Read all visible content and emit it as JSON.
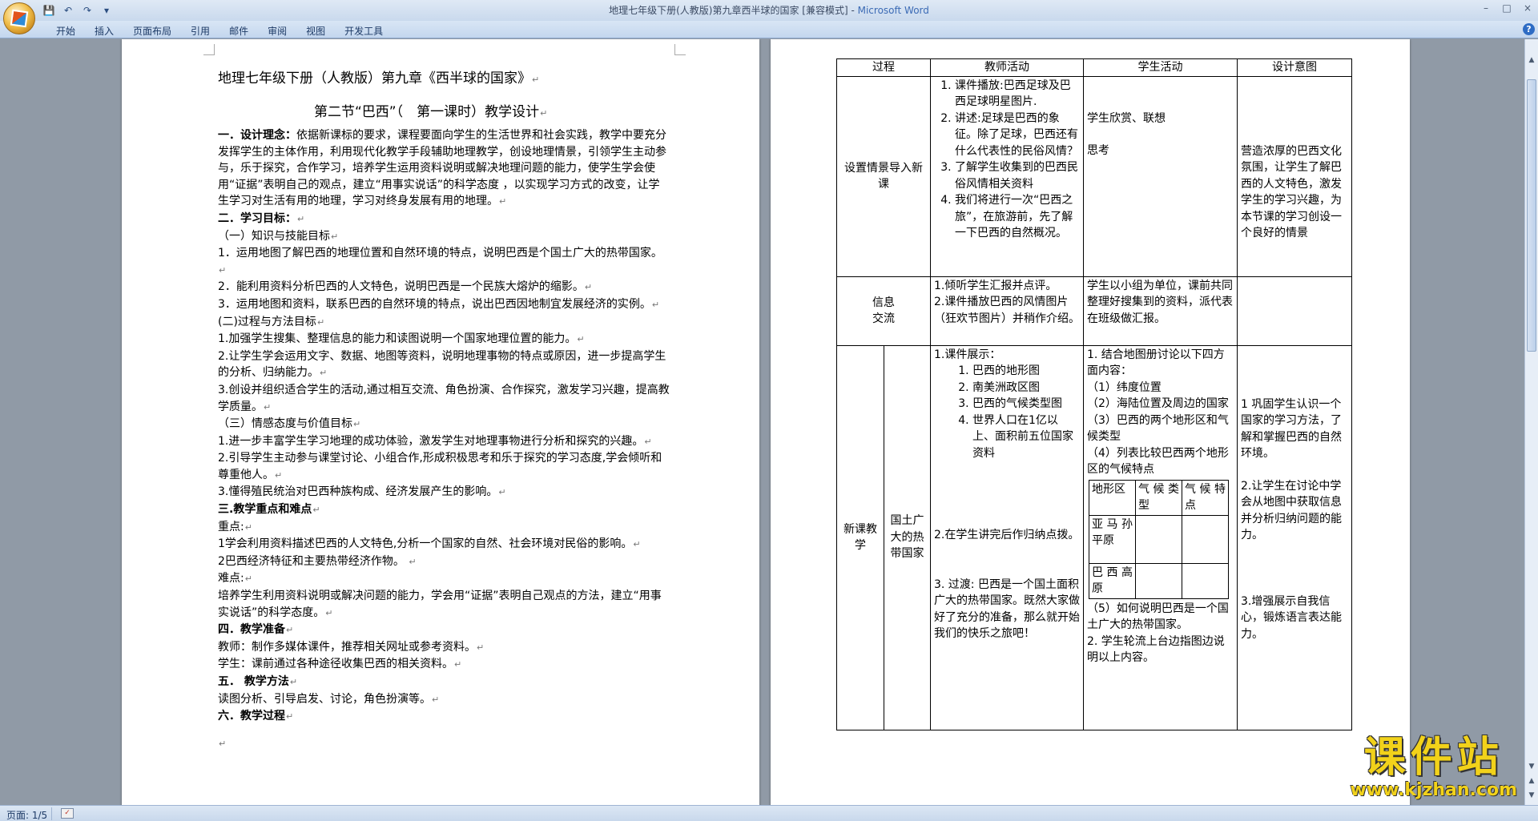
{
  "window": {
    "title": "地理七年级下册(人教版)第九章西半球的国家 [兼容模式] - ",
    "app_name": "Microsoft Word",
    "controls": [
      "–",
      "□",
      "×"
    ]
  },
  "quick_access": [
    {
      "name": "save-icon",
      "glyph": "💾"
    },
    {
      "name": "undo-icon",
      "glyph": "↶"
    },
    {
      "name": "redo-icon",
      "glyph": "↷"
    },
    {
      "name": "customize-icon",
      "glyph": "▾"
    }
  ],
  "ribbon": {
    "tabs": [
      "开始",
      "插入",
      "页面布局",
      "引用",
      "邮件",
      "审阅",
      "视图",
      "开发工具"
    ],
    "help": "?"
  },
  "left_page": {
    "title": "地理七年级下册（人教版）第九章《西半球的国家》",
    "subtitle": "第二节“巴西”（　第一课时）教学设计",
    "body": [
      {
        "label": "一．设计理念：",
        "text": "依据新课标的要求，课程要面向学生的生活世界和社会实践，教学中要充分发挥学生的主体作用，利用现代化教学手段辅助地理教学，创设地理情景，引领学生主动参与，乐于探究，合作学习，培养学生运用资料说明或解决地理问题的能力，使学生学会使用“证据”表明自己的观点，建立“用事实说话”的科学态度 ，以实现学习方式的改变，让学生学习对生活有用的地理，学习对终身发展有用的地理。"
      },
      {
        "label": "二．学习目标：",
        "text": ""
      },
      {
        "label": "",
        "text": "（一）知识与技能目标"
      },
      {
        "label": "",
        "text": "1．运用地图了解巴西的地理位置和自然环境的特点，说明巴西是个国土广大的热带国家。"
      },
      {
        "label": "",
        "text": "2．能利用资料分析巴西的人文特色，说明巴西是一个民族大熔炉的缩影。"
      },
      {
        "label": "",
        "text": "3．运用地图和资料，联系巴西的自然环境的特点，说出巴西因地制宜发展经济的实例。"
      },
      {
        "label": "",
        "text": "(二)过程与方法目标"
      },
      {
        "label": "",
        "text": "1.加强学生搜集、整理信息的能力和读图说明一个国家地理位置的能力。"
      },
      {
        "label": "",
        "text": "2.让学生学会运用文字、数据、地图等资料，说明地理事物的特点或原因，进一步提高学生的分析、归纳能力。"
      },
      {
        "label": "",
        "text": "3.创设并组织适合学生的活动,通过相互交流、角色扮演、合作探究，激发学习兴趣，提高教学质量。"
      },
      {
        "label": "",
        "text": "（三）情感态度与价值目标"
      },
      {
        "label": "",
        "text": "1.进一步丰富学生学习地理的成功体验，激发学生对地理事物进行分析和探究的兴趣。"
      },
      {
        "label": "",
        "text": "2.引导学生主动参与课堂讨论、小组合作,形成积极思考和乐于探究的学习态度,学会倾听和尊重他人。"
      },
      {
        "label": "",
        "text": "3.懂得殖民统治对巴西种族构成、经济发展产生的影响。"
      },
      {
        "label": "三.教学重点和难点",
        "text": ""
      },
      {
        "label": "",
        "text": "重点:"
      },
      {
        "label": "",
        "text": "1学会利用资料描述巴西的人文特色,分析一个国家的自然、社会环境对民俗的影响。"
      },
      {
        "label": "",
        "text": "2巴西经济特征和主要热带经济作物。 "
      },
      {
        "label": "",
        "text": "难点:"
      },
      {
        "label": "",
        "text": "培养学生利用资料说明或解决问题的能力，学会用“证据”表明自己观点的方法，建立“用事实说话”的科学态度。"
      },
      {
        "label": "四．教学准备",
        "text": ""
      },
      {
        "label": "",
        "text": "教师：制作多媒体课件，推荐相关网址或参考资料。"
      },
      {
        "label": "",
        "text": "学生：课前通过各种途径收集巴西的相关资料。"
      },
      {
        "label": "五．  教学方法",
        "text": ""
      },
      {
        "label": "",
        "text": "读图分析、引导启发、讨论，角色扮演等。"
      },
      {
        "label": "六．教学过程",
        "text": ""
      }
    ]
  },
  "right_page": {
    "headers": [
      "过程",
      "教师活动",
      "学生活动",
      "设计意图"
    ],
    "row1": {
      "process": "设置情景导入新课",
      "teacher": [
        "课件播放:巴西足球及巴西足球明星图片.",
        "讲述:足球是巴西的象征。除了足球，巴西还有什么代表性的民俗风情？",
        "了解学生收集到的巴西民俗风情相关资料",
        "我们将进行一次“巴西之旅”，在旅游前，先了解一下巴西的自然概况。"
      ],
      "student1": "学生欣赏、联想",
      "student2": " 思考",
      "intent": "营造浓厚的巴西文化氛围，让学生了解巴西的人文特色，激发学生的学习兴趣，为本节课的学习创设一个良好的情景"
    },
    "row2": {
      "process1": "信息",
      "process2": "交流",
      "teacher": "1.倾听学生汇报并点评。\n2.课件播放巴西的风情图片（狂欢节图片）并稍作介绍。",
      "student": "学生以小组为单位，课前共同整理好搜集到的资料，派代表在班级做汇报。",
      "intent": ""
    },
    "row3": {
      "stage": "新课教学",
      "topic": "国土广大的热带国家",
      "teacher_intro": "1.课件展示：",
      "teacher_items": [
        "巴西的地形图",
        "南美洲政区图",
        "巴西的气候类型图",
        "世界人口在1亿以上、面积前五位国家资料"
      ],
      "teacher_2": "2.在学生讲完后作归纳点拨。",
      "teacher_3": "3. 过渡: 巴西是一个国土面积广大的热带国家。既然大家做好了充分的准备，那么就开始我们的快乐之旅吧！",
      "student_intro": "1. 结合地图册讨论以下四方面内容：",
      "student_points": [
        "（1）纬度位置",
        "（2）海陆位置及周边的国家",
        "（3）巴西的两个地形区和气候类型",
        "（4）列表比较巴西两个地形区的气候特点"
      ],
      "climate_table": {
        "headers": [
          "地形区",
          "气候类型",
          "气候特点"
        ],
        "rows": [
          "亚马孙平原",
          "巴西高原"
        ]
      },
      "student_5": "（5）如何说明巴西是一个国土广大的热带国家。",
      "student_6": "2. 学生轮流上台边指图边说明以上内容。",
      "intent_1": "1 巩固学生认识一个国家的学习方法，了解和掌握巴西的自然环境。",
      "intent_2": "2.让学生在讨论中学会从地图中获取信息并分析归纳问题的能力。",
      "intent_3": "3.增强展示自我信心，锻炼语言表达能力。"
    }
  },
  "status": {
    "page": "页面: 1/5"
  },
  "watermark": {
    "main": "课件站",
    "url": "www.kjzhan.com"
  }
}
